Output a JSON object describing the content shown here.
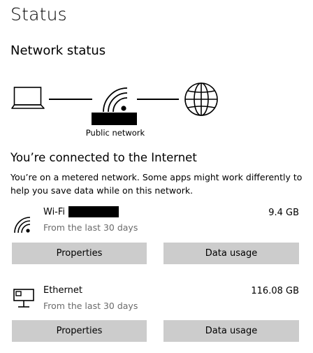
{
  "page": {
    "title": "Status"
  },
  "network_status": {
    "title": "Network status",
    "network_label": "Public network",
    "icons": [
      "laptop-icon",
      "wifi-icon",
      "globe-icon"
    ]
  },
  "connection_info": {
    "title": "You’re connected to the Internet",
    "metered_message": "You’re on a metered network. Some apps might work differently to help you save data while on this network."
  },
  "connections": [
    {
      "name": "Wi-Fi",
      "icon": "wifi-icon",
      "period": "From the last 30 days",
      "usage": "9.4 GB",
      "properties_label": "Properties",
      "data_usage_label": "Data usage"
    },
    {
      "name": "Ethernet",
      "icon": "ethernet-icon",
      "period": "From the last 30 days",
      "usage": "116.08 GB",
      "properties_label": "Properties",
      "data_usage_label": "Data usage"
    }
  ],
  "colors": {
    "button_bg": "#cccccc",
    "secondary_text": "#6b6b6b"
  }
}
